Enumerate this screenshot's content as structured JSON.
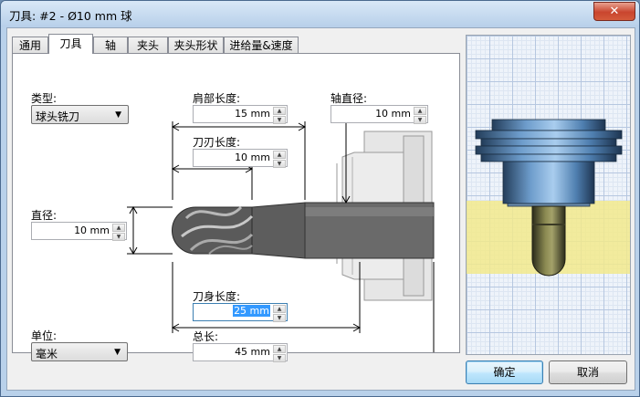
{
  "window": {
    "title": "刀具: #2 - Ø10 mm 球",
    "close_glyph": "✕"
  },
  "tabs": [
    "通用",
    "刀具",
    "轴",
    "夹头",
    "夹头形状",
    "进给量&速度"
  ],
  "active_tab": "刀具",
  "fields": {
    "type_label": "类型:",
    "type_value": "球头铣刀",
    "shoulder_label": "肩部长度:",
    "shoulder_value": "15 mm",
    "shaft_diam_label": "轴直径:",
    "shaft_diam_value": "10 mm",
    "flute_label": "刀刃长度:",
    "flute_value": "10 mm",
    "diameter_label": "直径:",
    "diameter_value": "10 mm",
    "body_label": "刀身长度:",
    "body_value": "25 mm",
    "overall_label": "总长:",
    "overall_value": "45 mm",
    "unit_label": "单位:",
    "unit_value": "毫米"
  },
  "buttons": {
    "ok": "确定",
    "cancel": "取消"
  },
  "colors": {
    "tool_body": "#6a6a6a",
    "holder": "#4f7fb0",
    "highlight_zone": "#f2e98c",
    "selection": "#3399ff"
  }
}
